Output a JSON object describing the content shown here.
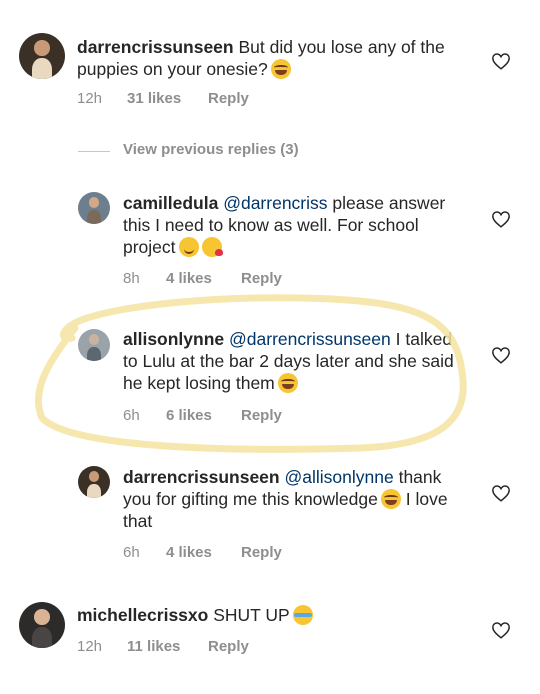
{
  "comments": [
    {
      "username": "darrencrissunseen",
      "mention": "",
      "text": "But did you lose any of the puppies on your onesie?",
      "emoji": "laughing-tears",
      "time": "12h",
      "likes": "31 likes",
      "reply": "Reply"
    },
    {
      "username": "camilledula",
      "mention": "@darrencriss",
      "text": "please answer this I need to know as well. For school project",
      "emoji": "smile, kissing-heart",
      "time": "8h",
      "likes": "4 likes",
      "reply": "Reply"
    },
    {
      "username": "allisonlynne",
      "mention": "@darrencrissunseen",
      "text": "I talked to Lulu at the bar 2 days later and she said he kept losing them",
      "emoji": "laughing-tears",
      "time": "6h",
      "likes": "6 likes",
      "reply": "Reply"
    },
    {
      "username": "darrencrissunseen",
      "mention": "@allisonlynne",
      "text_before": "thank you for gifting me this knowledge",
      "text_after": "I love that",
      "emoji": "laughing-tears",
      "time": "6h",
      "likes": "4 likes",
      "reply": "Reply"
    },
    {
      "username": "michellecrissxo",
      "mention": "",
      "text": "SHUT UP",
      "emoji": "crying",
      "time": "12h",
      "likes": "11 likes",
      "reply": "Reply"
    }
  ],
  "view_previous": "View previous replies (3)",
  "colors": {
    "highlight": "#f5e3a0",
    "meta": "#8e8e8e",
    "mention": "#003569"
  }
}
